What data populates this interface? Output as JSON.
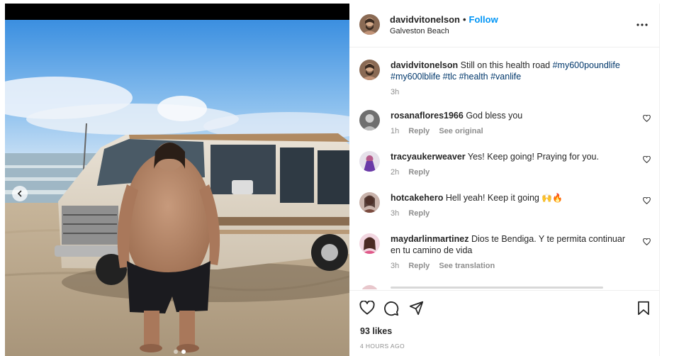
{
  "post": {
    "username": "davidvitonelson",
    "separator": "•",
    "follow_label": "Follow",
    "location": "Galveston Beach",
    "more_icon": "more-horizontal-icon",
    "caption": {
      "username": "davidvitonelson",
      "text": "Still on this health road",
      "tags": [
        "#my600poundlife",
        "#my600lblife",
        "#tlc",
        "#health",
        "#vanlife"
      ],
      "time": "3h"
    }
  },
  "comments": [
    {
      "user": "rosanaflores1966",
      "text": "God bless you",
      "time": "1h",
      "reply": "Reply",
      "extra": "See original"
    },
    {
      "user": "tracyaukerweaver",
      "text": "Yes! Keep going! Praying for you.",
      "time": "2h",
      "reply": "Reply",
      "extra": ""
    },
    {
      "user": "hotcakehero",
      "text": "Hell yeah! Keep it going",
      "emoji": "🙌🔥",
      "time": "3h",
      "reply": "Reply",
      "extra": ""
    },
    {
      "user": "maydarlinmartinez",
      "text": "Dios te Bendiga. Y te permita continuar en tu camino de vida",
      "time": "3h",
      "reply": "Reply",
      "extra": "See translation"
    }
  ],
  "actions": {
    "like_icon": "heart-icon",
    "comment_icon": "comment-icon",
    "share_icon": "send-icon",
    "save_icon": "bookmark-icon"
  },
  "likes": "93 likes",
  "post_time": "4 HOURS AGO",
  "carousel": {
    "prev_icon": "chevron-left-icon",
    "total": 2,
    "current": 2
  },
  "colors": {
    "accent": "#0095f6",
    "hashtag": "#00376b",
    "muted": "#8e8e8e",
    "text": "#262626"
  }
}
